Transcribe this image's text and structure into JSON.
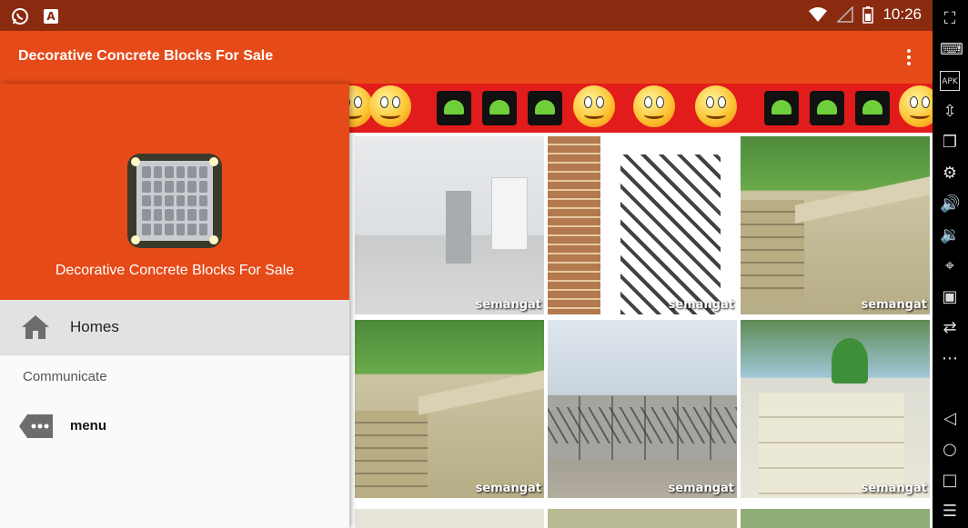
{
  "status_bar": {
    "time": "10:26",
    "app_notice_letter": "A"
  },
  "app_bar": {
    "title": "Decorative Concrete Blocks For Sale"
  },
  "drawer": {
    "app_name": "Decorative Concrete Blocks For Sale",
    "items": [
      {
        "label": "Homes",
        "icon": "home-icon",
        "selected": true
      },
      {
        "label": "menu",
        "icon": "more-horiz-tag-icon",
        "selected": false
      }
    ],
    "section_label": "Communicate"
  },
  "content": {
    "watermark": "semangat"
  },
  "colors": {
    "app_bar": "#e64a19",
    "status_bar": "#8a2b10",
    "selected_item": "#e2e2e2",
    "banner": "#e21b1b"
  }
}
